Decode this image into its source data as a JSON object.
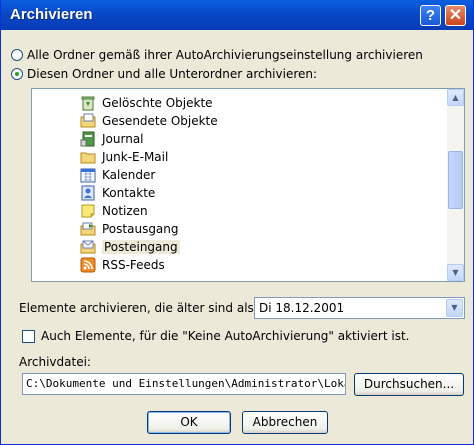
{
  "window": {
    "title": "Archivieren",
    "help_label": "?",
    "close_label": "✕"
  },
  "radio_all": {
    "label": "Alle Ordner gemäß ihrer AutoArchivierungseinstellung archivieren",
    "checked": false
  },
  "radio_this": {
    "label": "Diesen Ordner und alle Unterordner archivieren:",
    "checked": true
  },
  "folders": [
    {
      "label": "Gelöschte Objekte",
      "icon": "recycle-bin-icon"
    },
    {
      "label": "Gesendete Objekte",
      "icon": "sent-folder-icon"
    },
    {
      "label": "Journal",
      "icon": "journal-icon"
    },
    {
      "label": "Junk-E-Mail",
      "icon": "folder-icon"
    },
    {
      "label": "Kalender",
      "icon": "calendar-icon"
    },
    {
      "label": "Kontakte",
      "icon": "contacts-icon"
    },
    {
      "label": "Notizen",
      "icon": "notes-icon"
    },
    {
      "label": "Postausgang",
      "icon": "outbox-icon"
    },
    {
      "label": "Posteingang",
      "icon": "inbox-icon",
      "selected": true
    },
    {
      "label": "RSS-Feeds",
      "icon": "rss-icon"
    }
  ],
  "older_than": {
    "label": "Elemente archivieren, die älter sind als:",
    "value": "Di 18.12.2001"
  },
  "include_no_autoarchive": {
    "label": "Auch Elemente, für die \"Keine AutoArchivierung\" aktiviert ist.",
    "checked": false
  },
  "archive_file": {
    "label": "Archivdatei:",
    "value": "C:\\Dokumente und Einstellungen\\Administrator\\Lokale Eir",
    "browse_label": "Durchsuchen..."
  },
  "buttons": {
    "ok": "OK",
    "cancel": "Abbrechen"
  },
  "colors": {
    "title_bar": "#0a54d6",
    "dialog_bg": "#ece9d8",
    "field_border": "#7f9db9"
  }
}
